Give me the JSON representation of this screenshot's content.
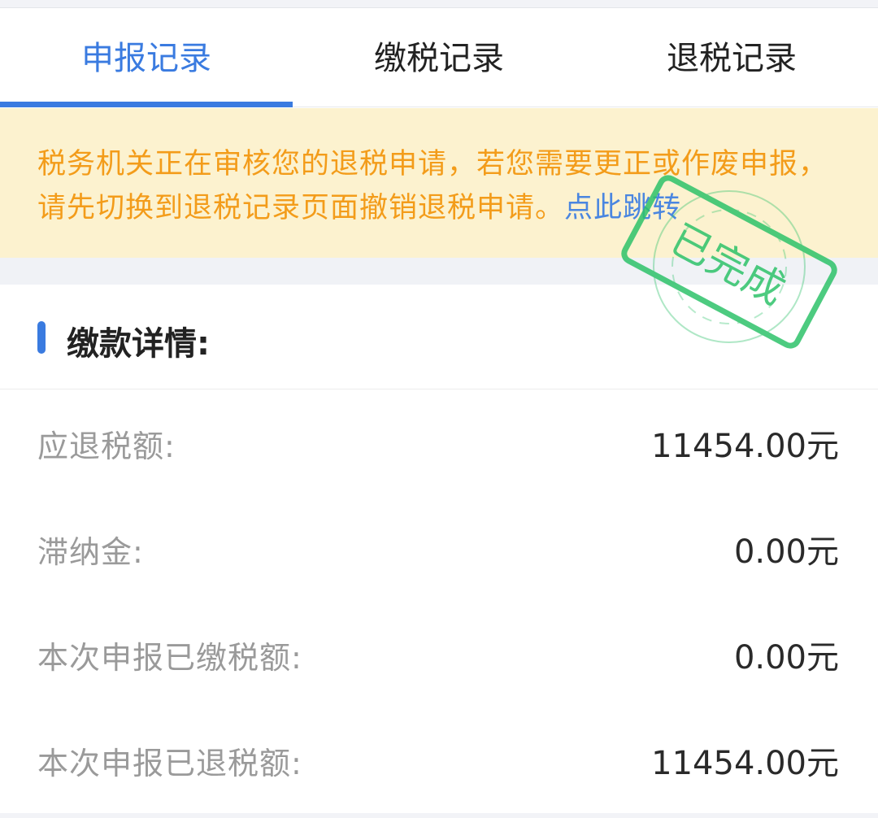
{
  "tabs": [
    {
      "label": "申报记录",
      "active": true
    },
    {
      "label": "缴税记录",
      "active": false
    },
    {
      "label": "退税记录",
      "active": false
    }
  ],
  "notice": {
    "text": "税务机关正在审核您的退税申请，若您需要更正或作废申报，请先切换到退税记录页面撤销退税申请。",
    "link_text": "点此跳转"
  },
  "stamp": {
    "label": "已完成",
    "color": "#2ec26a"
  },
  "section": {
    "title": "缴款详情:"
  },
  "rows": [
    {
      "label": "应退税额:",
      "value": "11454.00元"
    },
    {
      "label": "滞纳金:",
      "value": "0.00元"
    },
    {
      "label": "本次申报已缴税额:",
      "value": "0.00元"
    },
    {
      "label": "本次申报已退税额:",
      "value": "11454.00元"
    }
  ],
  "colors": {
    "accent": "#3a7be0",
    "notice_bg": "#fcf2cf",
    "notice_text": "#f39c1a"
  }
}
